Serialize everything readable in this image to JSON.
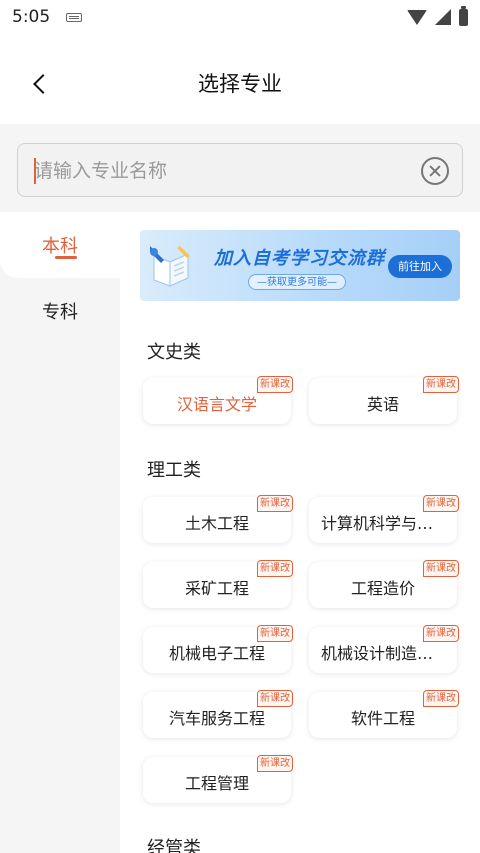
{
  "status": {
    "time": "5:05"
  },
  "header": {
    "title": "选择专业"
  },
  "search": {
    "placeholder": "请输入专业名称",
    "value": ""
  },
  "tabs": [
    {
      "label": "本科",
      "active": true
    },
    {
      "label": "专科",
      "active": false
    }
  ],
  "banner": {
    "title": "加入自考学习交流群",
    "subtitle": "—获取更多可能—",
    "button": "前往加入"
  },
  "badge_text": "新课改",
  "sections": [
    {
      "title": "文史类",
      "items": [
        "汉语言文学",
        "英语"
      ]
    },
    {
      "title": "理工类",
      "items": [
        "土木工程",
        "计算机科学与技...",
        "采矿工程",
        "工程造价",
        "机械电子工程",
        "机械设计制造及...",
        "汽车服务工程",
        "软件工程",
        "工程管理"
      ]
    },
    {
      "title": "经管类",
      "items": []
    }
  ],
  "colors": {
    "accent": "#e0623c",
    "banner_blue": "#1d6fd8"
  }
}
